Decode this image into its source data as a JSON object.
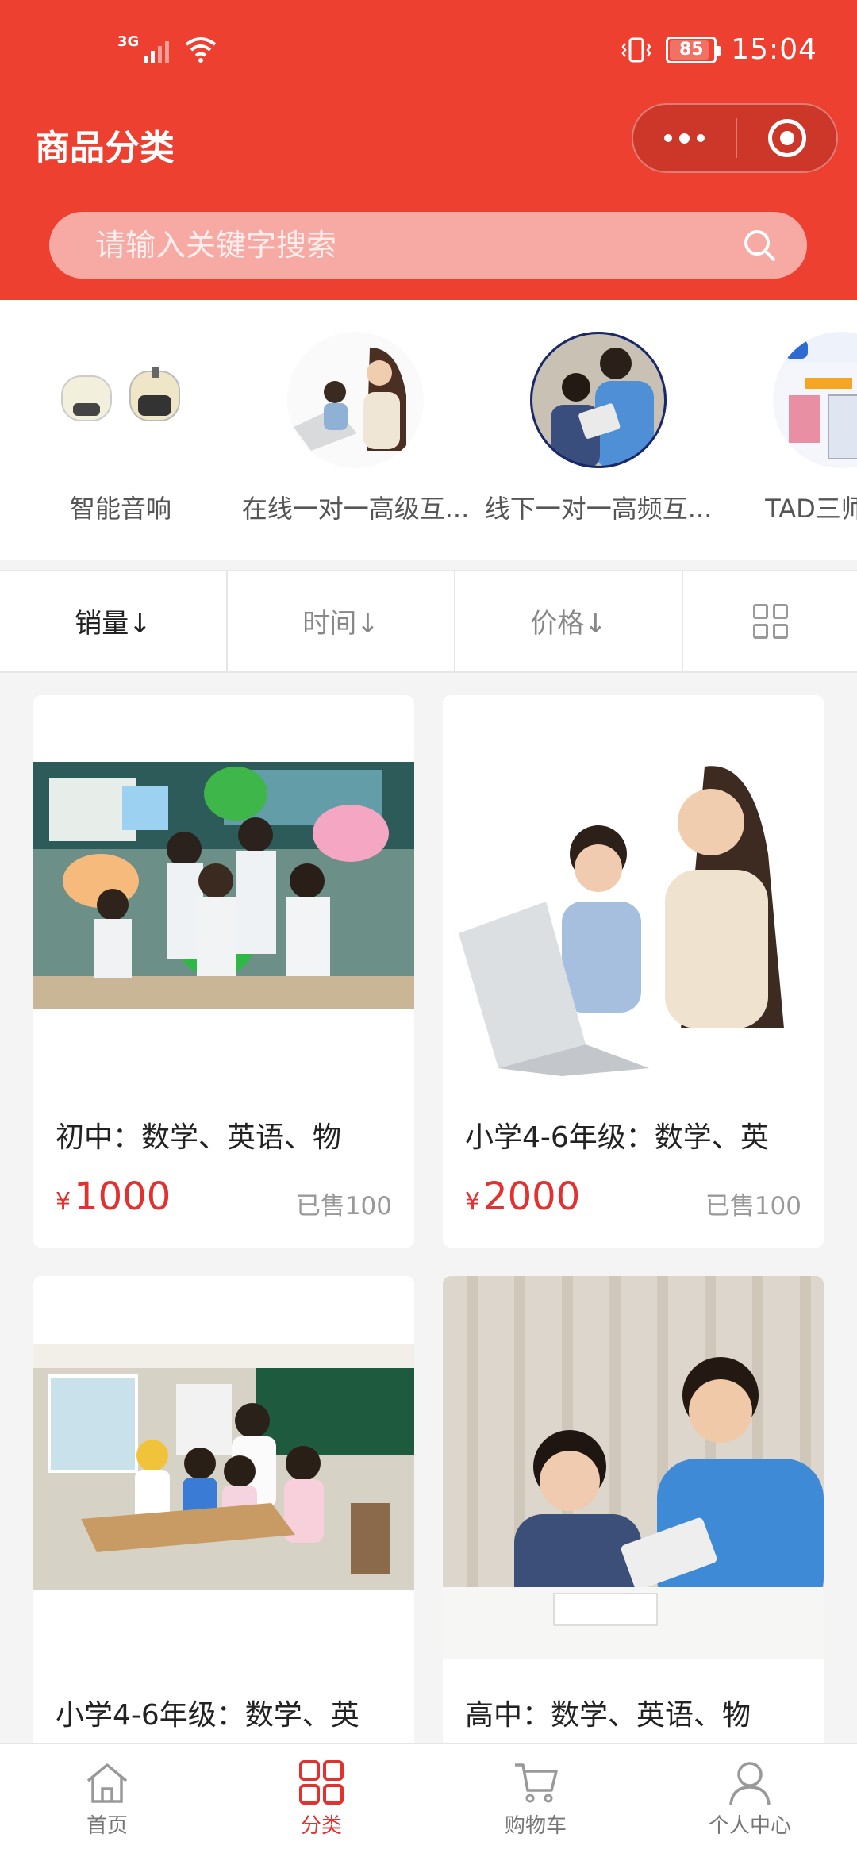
{
  "status_bar": {
    "network": "3G",
    "battery": "85",
    "time": "15:04"
  },
  "header": {
    "title": "商品分类"
  },
  "search": {
    "placeholder": "请输入关键字搜索"
  },
  "categories": [
    {
      "label": "智能音响"
    },
    {
      "label": "在线一对一高级互..."
    },
    {
      "label": "线下一对一高频互..."
    },
    {
      "label": "TAD三师课堂"
    }
  ],
  "sort_bar": {
    "sales": "销量↓",
    "time": "时间↓",
    "price": "价格↓",
    "layout_icon": "grid-icon"
  },
  "products": [
    {
      "title": "初中：数学、英语、物",
      "currency": "¥",
      "price": "1000",
      "sold": "已售100"
    },
    {
      "title": "小学4-6年级：数学、英",
      "currency": "¥",
      "price": "2000",
      "sold": "已售100"
    },
    {
      "title": "小学4-6年级：数学、英"
    },
    {
      "title": "高中：数学、英语、物"
    }
  ],
  "tabbar": [
    {
      "label": "首页",
      "icon": "home-icon"
    },
    {
      "label": "分类",
      "icon": "category-icon",
      "active": true
    },
    {
      "label": "购物车",
      "icon": "cart-icon"
    },
    {
      "label": "个人中心",
      "icon": "user-icon"
    }
  ],
  "colors": {
    "accent": "#ee4030",
    "price": "#e3312f"
  }
}
